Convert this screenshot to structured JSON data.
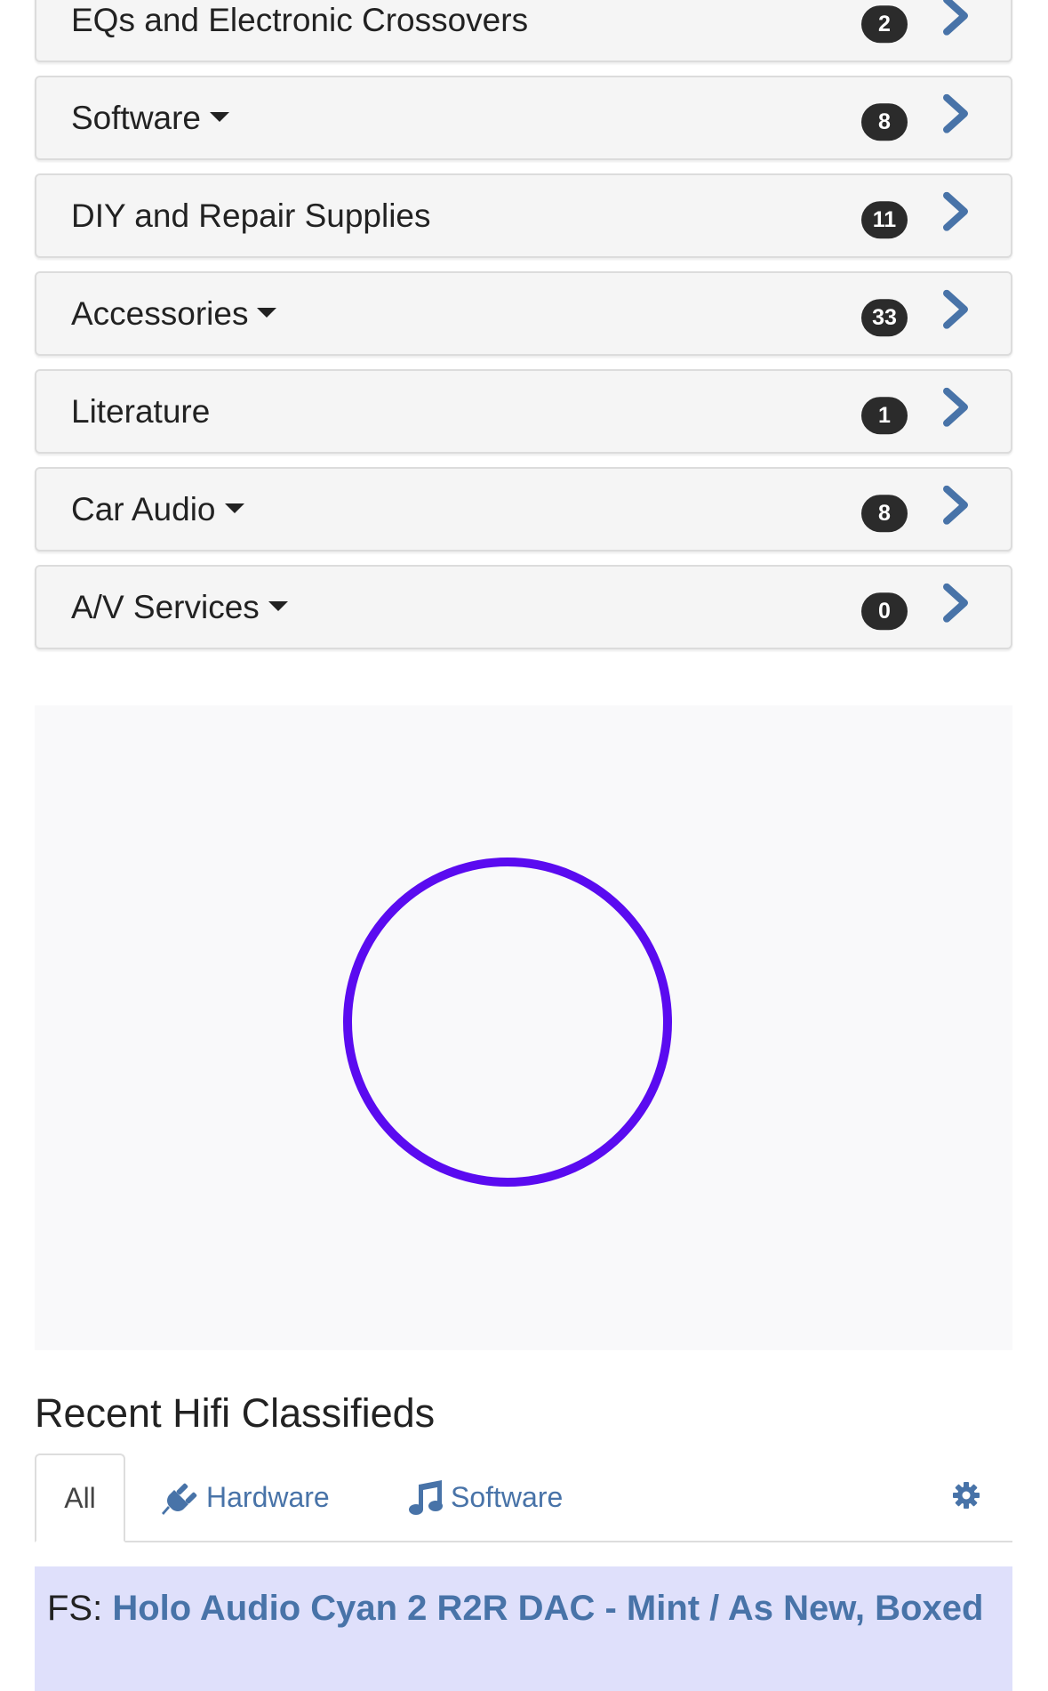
{
  "categories": [
    {
      "label": "EQs and Electronic Crossovers",
      "count": "2",
      "has_dropdown": false
    },
    {
      "label": "Software",
      "count": "8",
      "has_dropdown": true
    },
    {
      "label": "DIY and Repair Supplies",
      "count": "11",
      "has_dropdown": false
    },
    {
      "label": "Accessories",
      "count": "33",
      "has_dropdown": true
    },
    {
      "label": "Literature",
      "count": "1",
      "has_dropdown": false
    },
    {
      "label": "Car Audio",
      "count": "8",
      "has_dropdown": true
    },
    {
      "label": "A/V Services",
      "count": "0",
      "has_dropdown": true
    }
  ],
  "colors": {
    "accent": "#4873a8",
    "spinner": "#5a0bf0",
    "badge": "#2b2b2b",
    "listing_bg": "#dfe0fb"
  },
  "recent": {
    "title": "Recent Hifi Classifieds",
    "tabs": [
      {
        "label": "All",
        "icon": null,
        "active": true
      },
      {
        "label": "Hardware",
        "icon": "plug-icon",
        "active": false
      },
      {
        "label": "Software",
        "icon": "music-note-icon",
        "active": false
      }
    ],
    "settings_icon": "gear-icon"
  },
  "listing": {
    "prefix": "FS: ",
    "title": "Holo Audio Cyan 2 R2R DAC - Mint / As New, Boxed"
  }
}
